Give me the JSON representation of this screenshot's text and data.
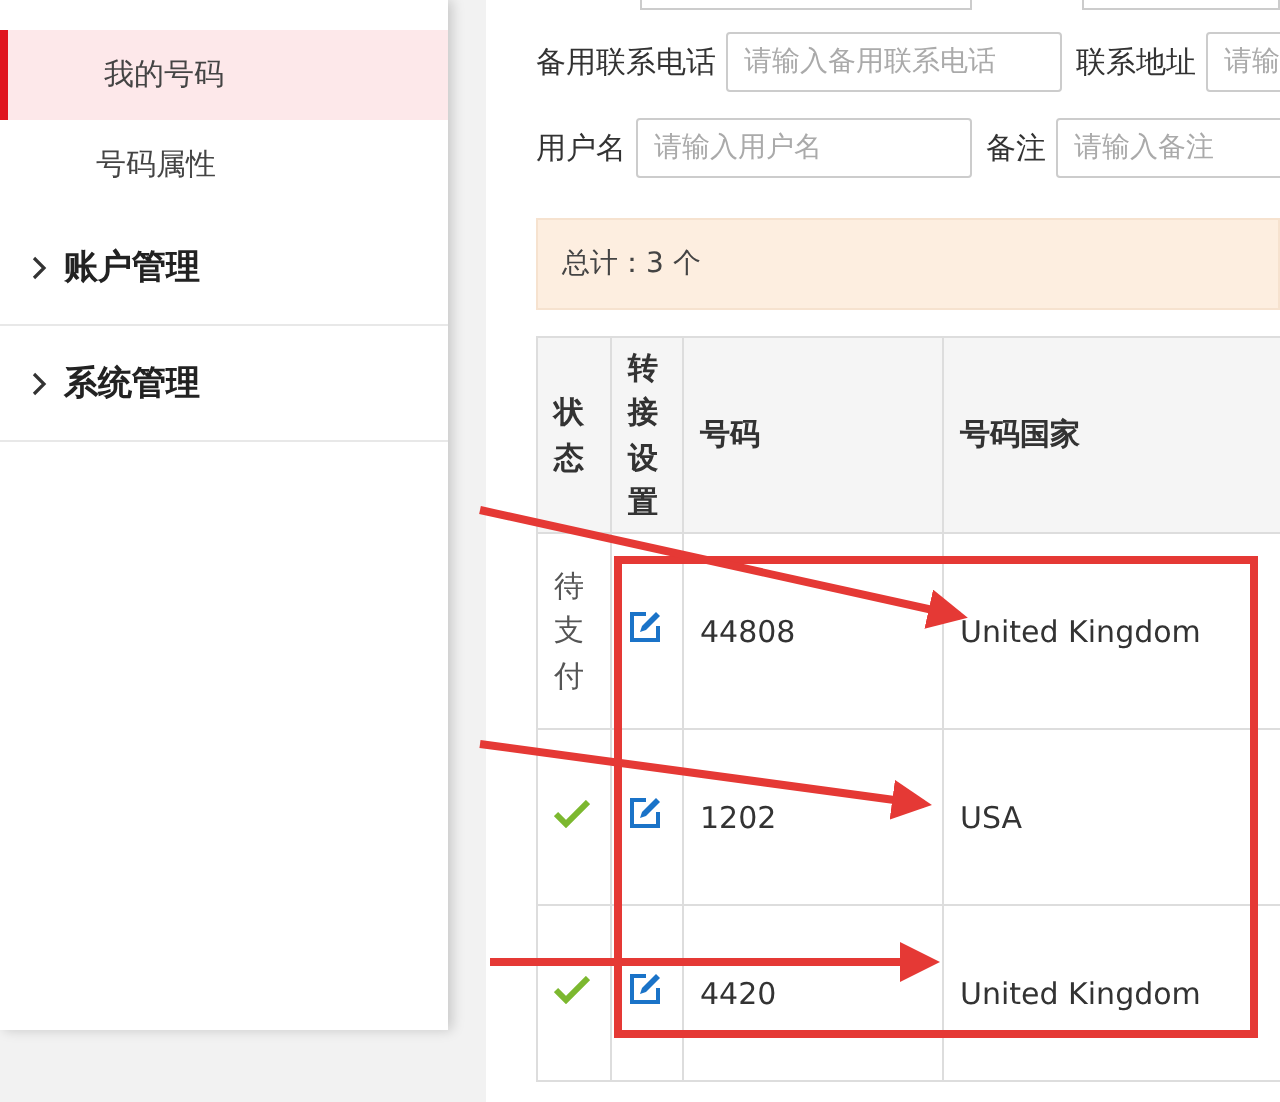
{
  "sidebar": {
    "items": [
      {
        "label": "我的号码",
        "selected": true
      },
      {
        "label": "号码属性",
        "selected": false
      }
    ],
    "groups": [
      {
        "label": "账户管理",
        "expanded": false
      },
      {
        "label": "系统管理",
        "expanded": false
      }
    ]
  },
  "filters": [
    [
      {
        "label": "备用联系电话",
        "placeholder": "请输入备用联系电话"
      },
      {
        "label": "联系地址",
        "placeholder": "请输"
      }
    ],
    [
      {
        "label": "用户名",
        "placeholder": "请输入用户名"
      },
      {
        "label": "备注",
        "placeholder": "请输入备注"
      }
    ]
  ],
  "summary": "总计：3 个",
  "table": {
    "columns": [
      "状态",
      "转接设置",
      "号码",
      "号码国家"
    ],
    "rows": [
      {
        "status": {
          "kind": "text",
          "text": "待支付"
        },
        "number": "44808",
        "country": "United Kingdom"
      },
      {
        "status": {
          "kind": "check"
        },
        "number": "1202",
        "country": "USA"
      },
      {
        "status": {
          "kind": "check"
        },
        "number": "4420",
        "country": "United Kingdom"
      }
    ]
  }
}
